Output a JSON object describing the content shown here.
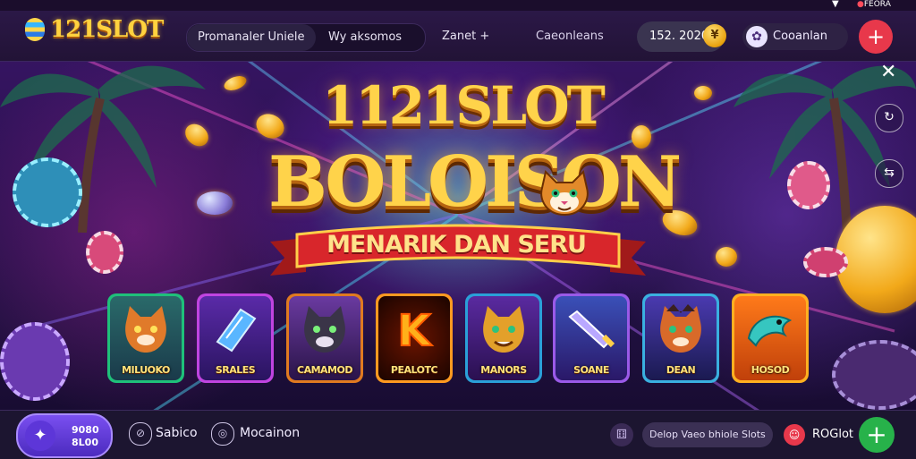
{
  "header": {
    "logo_text": "121SLOT",
    "nav_pill_active": "Promanaler Uniele",
    "nav_pill_second": "Wy aksomos",
    "nav_zanet": "Zanet +",
    "nav_casino": "Caeonleans",
    "balance": "152. 2020",
    "coin_symbol": "¥",
    "user_label": "Cooanlan",
    "plus_label": "+"
  },
  "system": {
    "indicator": "▼",
    "rec_dot": "●",
    "rec_text": "FEORA"
  },
  "side_controls": {
    "close": "✕"
  },
  "hero": {
    "title_line1": "1121SLOT",
    "title_line2": "BOLOISON",
    "ribbon_text": "MENARIK DAN SERU"
  },
  "games": [
    {
      "label": "MILUOKO"
    },
    {
      "label": "SRALES"
    },
    {
      "label": "CAMAMOD"
    },
    {
      "label": "PEALOTC"
    },
    {
      "label": "MANORS"
    },
    {
      "label": "SOANE"
    },
    {
      "label": "DEAN"
    },
    {
      "label": "HOSOD"
    }
  ],
  "bottom": {
    "badge_line1": "9080",
    "badge_line2": "8L00",
    "item1": "Sabico",
    "item2": "Mocainon",
    "promo_text": "Delop Vaeo bhiole Slots",
    "profile_label": "ROGlot",
    "plus_label": "+"
  },
  "colors": {
    "accent_gold": "#ffd34a",
    "red_button": "#e8384b",
    "green_button": "#27b24a",
    "purple_badge": "#6a44e6"
  }
}
